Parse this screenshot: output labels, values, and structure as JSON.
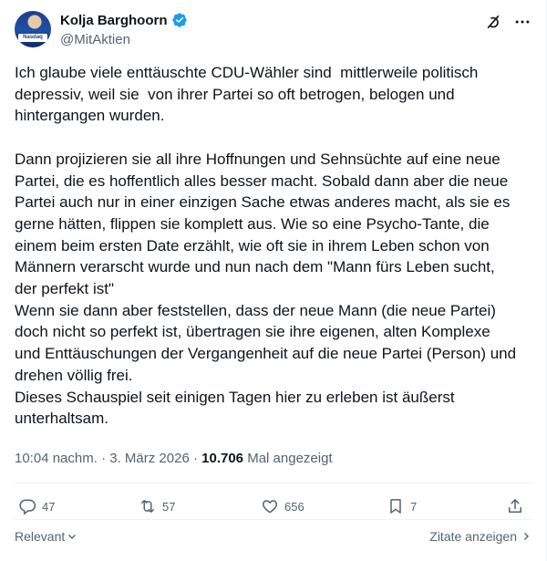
{
  "author": {
    "display_name": "Kolja Barghoorn",
    "handle": "@MitAktien",
    "avatar_text": "Nasdaq"
  },
  "tweet": {
    "text": "Ich glaube viele enttäuschte CDU-Wähler sind  mittlerweile politisch\ndepressiv, weil sie  von ihrer Partei so oft betrogen, belogen und\nhintergangen wurden.\n\nDann projizieren sie all ihre Hoffnungen und Sehnsüchte auf eine neue\nPartei, die es hoffentlich alles besser macht. Sobald dann aber die neue\nPartei auch nur in einer einzigen Sache etwas anderes macht, als sie es\ngerne hätten, flippen sie komplett aus. Wie so eine Psycho-Tante, die\neinem beim ersten Date erzählt, wie oft sie in ihrem Leben schon von\nMännern verarscht wurde und nun nach dem \"Mann fürs Leben sucht,\nder perfekt ist\"\nWenn sie dann aber feststellen, dass der neue Mann (die neue Partei)\ndoch nicht so perfekt ist, übertragen sie ihre eigenen, alten Komplexe\nund Enttäuschungen der Vergangenheit auf die neue Partei (Person) und\ndrehen völlig frei.\nDieses Schauspiel seit einigen Tagen hier zu erleben ist äußerst\nunterhaltsam.",
    "time": "10:04 nachm.",
    "separator": "·",
    "date": "3. März 2026",
    "views": "10.706",
    "views_label": "Mal angezeigt"
  },
  "actions": {
    "replies": "47",
    "reposts": "57",
    "likes": "656",
    "bookmarks": "7"
  },
  "footer": {
    "sort_label": "Relevant",
    "quotes_label": "Zitate anzeigen"
  },
  "colors": {
    "verified": "#1d9bf0",
    "text": "#0f1419",
    "secondary": "#536471",
    "divider": "#eff3f4"
  },
  "icons": [
    "verified-badge-icon",
    "grok-icon",
    "more-icon",
    "reply-icon",
    "repost-icon",
    "like-icon",
    "bookmark-icon",
    "share-icon",
    "chevron-down-icon",
    "chevron-right-icon"
  ]
}
